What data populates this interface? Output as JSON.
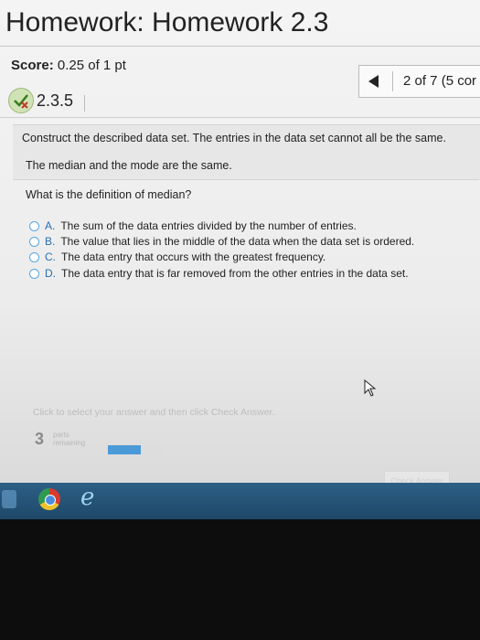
{
  "header": {
    "title": "Homework: Homework 2.3",
    "score_label": "Score:",
    "score_value": "0.25 of 1 pt",
    "nav_count": "2 of 7 (5 cor"
  },
  "question": {
    "number": "2.3.5",
    "instruction": "Construct the described data set. The entries in the data set cannot all be the same.",
    "condition": "The median and the mode are the same.",
    "prompt": "What is the definition of median?",
    "options": [
      {
        "letter": "A.",
        "text": "The sum of the data entries divided by the number of entries."
      },
      {
        "letter": "B.",
        "text": "The value that lies in the middle of the data when the data set is ordered."
      },
      {
        "letter": "C.",
        "text": "The data entry that occurs with the greatest frequency."
      },
      {
        "letter": "D.",
        "text": "The data entry that is far removed from the other entries in the data set."
      }
    ]
  },
  "footer": {
    "hint": "Click to select your answer and then click Check Answer.",
    "parts_count": "3",
    "parts_label": "parts remaining",
    "progress_fraction": 0.6,
    "check_answer_label": "Check Answer"
  },
  "colors": {
    "accent": "#4a9ad8",
    "radio_border": "#5aa6df",
    "taskbar": "#2d5f86"
  },
  "icons": {
    "prev": "arrow-left-icon",
    "question_status": "partial-check-icon",
    "cursor": "mouse-pointer-icon",
    "browser1": "chrome-icon",
    "browser2": "internet-explorer-icon"
  }
}
